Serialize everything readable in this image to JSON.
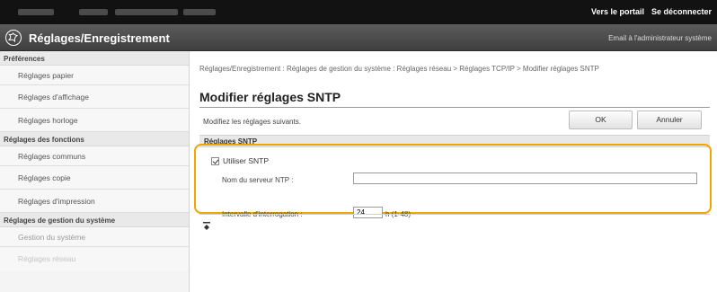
{
  "header": {
    "portal_link": "Vers le portail",
    "logout_link": "Se déconnecter"
  },
  "titlebar": {
    "title": "Réglages/Enregistrement",
    "mail_link": "Email à l'administrateur système"
  },
  "sidebar": {
    "sections": [
      {
        "title": "Préférences",
        "items": [
          "Réglages papier",
          "Réglages d'affichage",
          "Réglages horloge"
        ]
      },
      {
        "title": "Réglages des fonctions",
        "items": [
          "Réglages communs",
          "Réglages copie",
          "Réglages d'impression"
        ]
      },
      {
        "title": "Réglages de gestion du système",
        "items": [
          "Gestion du système",
          "Réglages réseau"
        ]
      }
    ]
  },
  "main": {
    "breadcrumb": "Réglages/Enregistrement : Réglages de gestion du système : Réglages réseau > Réglages TCP/IP > Modifier réglages SNTP",
    "page_title": "Modifier réglages SNTP",
    "instruction": "Modifiez les réglages suivants.",
    "ok_label": "OK",
    "cancel_label": "Annuler",
    "section_title": "Réglages SNTP",
    "use_sntp_label": "Utiliser SNTP",
    "use_sntp_checked": true,
    "ntp_server_label": "Nom du serveur NTP :",
    "ntp_server_value": "",
    "polling_label": "Intervalle d'interrogation :",
    "polling_value": "24",
    "polling_unit": "h (1-48)"
  },
  "colors": {
    "highlight": "#f2a400",
    "topbar": "#121212",
    "titlebar": "#4a4a4a"
  },
  "icons": [
    "register-settings-logo-icon",
    "page-top-icon"
  ]
}
